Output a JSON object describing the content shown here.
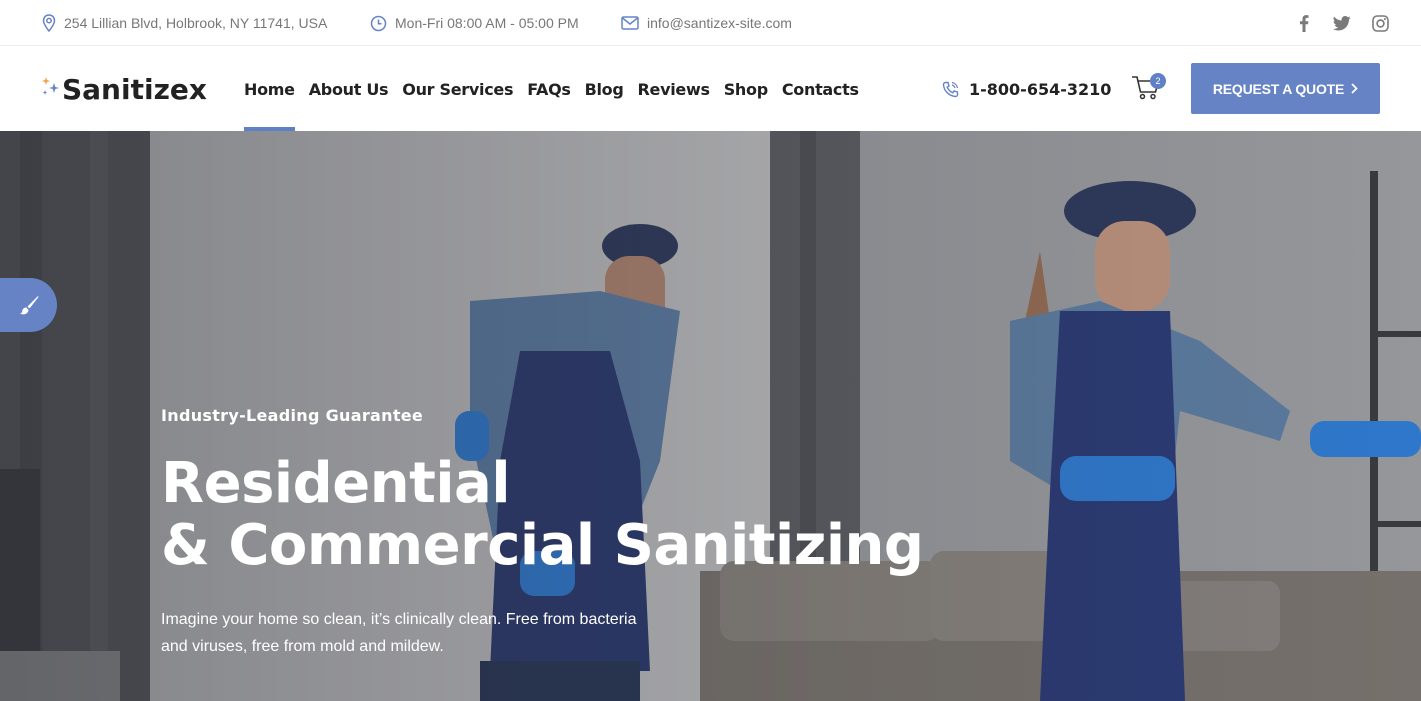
{
  "topbar": {
    "address": "254 Lillian Blvd, Holbrook, NY 11741, USA",
    "hours": "Mon-Fri 08:00 AM - 05:00 PM",
    "email": "info@santizex-site.com",
    "socials": [
      "facebook-icon",
      "twitter-icon",
      "instagram-icon"
    ]
  },
  "header": {
    "logo": "Sanitizex",
    "nav": [
      {
        "label": "Home",
        "active": true
      },
      {
        "label": "About Us"
      },
      {
        "label": "Our Services"
      },
      {
        "label": "FAQs"
      },
      {
        "label": "Blog"
      },
      {
        "label": "Reviews"
      },
      {
        "label": "Shop"
      },
      {
        "label": "Contacts"
      }
    ],
    "phone": "1-800-654-3210",
    "cart_count": "2",
    "quote_button": "REQUEST A QUOTE"
  },
  "hero": {
    "kicker": "Industry-Leading Guarantee",
    "title_line1": "Residential",
    "title_line2": "& Commercial Sanitizing",
    "text_line1": "Imagine your home so clean, it’s clinically clean. Free from bacteria",
    "text_line2": "and viruses, free from mold and mildew."
  },
  "colors": {
    "accent": "#6683c6",
    "text": "#222222",
    "muted": "#777777"
  }
}
